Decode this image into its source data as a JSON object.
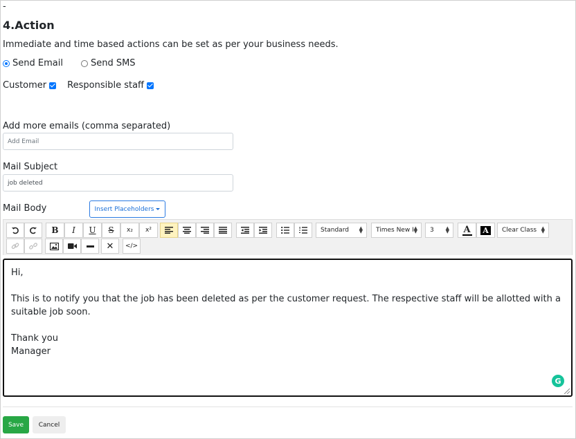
{
  "section": {
    "dash": "-",
    "title": "4.Action",
    "description": "Immediate and time based actions can be set as per your business needs."
  },
  "channel": {
    "send_email_label": "Send Email",
    "send_email_selected": true,
    "send_sms_label": "Send SMS",
    "send_sms_selected": false
  },
  "recipients": {
    "customer_label": "Customer",
    "customer_checked": true,
    "staff_label": "Responsible staff",
    "staff_checked": true
  },
  "emails": {
    "label": "Add more emails (comma separated)",
    "placeholder": "Add Email",
    "value": ""
  },
  "subject": {
    "label": "Mail Subject",
    "value": "job deleted"
  },
  "body": {
    "label": "Mail Body",
    "insert_placeholders_label": "Insert Placeholders",
    "lines": [
      "Hi,",
      "",
      "This is to notify you that the job has been deleted as per the customer request.  The respective staff will be allotted with a suitable job soon.",
      "",
      "Thank you",
      "Manager"
    ]
  },
  "toolbar": {
    "bold": "B",
    "italic": "I",
    "underline": "U",
    "strike": "S",
    "subscript": "x₂",
    "superscript": "x²",
    "style_select": "Standard",
    "font_select": "Times New I",
    "size_select": "3",
    "text_color": "A",
    "bg_color": "A",
    "clear_class": "Clear Class"
  },
  "actions": {
    "save": "Save",
    "cancel": "Cancel"
  },
  "colors": {
    "accent_blue": "#0075ff",
    "save_green": "#28a745",
    "active_align": "#fff3bf",
    "grammarly": "#15c39a"
  }
}
